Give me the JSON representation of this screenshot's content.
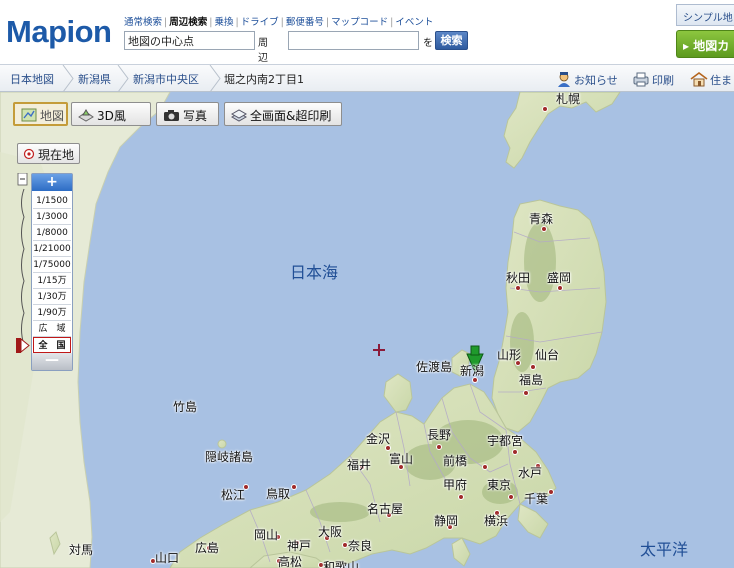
{
  "header": {
    "logo": "Mapion",
    "search_tabs": [
      "通常検索",
      "周辺検索",
      "乗換",
      "ドライブ",
      "郵便番号",
      "マップコード",
      "イベント"
    ],
    "active_tab_index": 1,
    "center_input_value": "地図の中心点",
    "nearby_label": "周辺で",
    "keyword_input_value": "",
    "wo_label": "を",
    "search_button": "検索",
    "simple_tab": "シンプル地",
    "map_green_tab": "地図カ"
  },
  "breadcrumb": [
    "日本地図",
    "新潟県",
    "新潟市中央区",
    "堀之内南2丁目1"
  ],
  "tools": {
    "news": "お知らせ",
    "print": "印刷",
    "residence": "住ま"
  },
  "map_toolbar": {
    "map": "地図",
    "threed": "3D風",
    "photo": "写真",
    "fullscreen": "全画面&超印刷",
    "current_location": "現在地"
  },
  "zoom": {
    "in": "+",
    "out": "—",
    "levels": [
      "1/1500",
      "1/3000",
      "1/8000",
      "1/21000",
      "1/75000",
      "1/15万",
      "1/30万",
      "1/90万",
      "広　域",
      "全　国"
    ],
    "selected_index": 9
  },
  "map": {
    "seas": {
      "sea_of_japan": "日本海",
      "pacific": "太平洋"
    },
    "places": {
      "sapporo": "札幌",
      "aomori": "青森",
      "akita": "秋田",
      "morioka": "盛岡",
      "sadogashima": "佐渡島",
      "niigata": "新潟",
      "yamagata": "山形",
      "sendai": "仙台",
      "fukushima": "福島",
      "takeshima": "竹島",
      "kanazawa": "金沢",
      "nagano": "長野",
      "utsunomiya": "宇都宮",
      "oki": "隠岐諸島",
      "fukui": "福井",
      "toyama": "富山",
      "maebashi": "前橋",
      "mito": "水戸",
      "kofu": "甲府",
      "tokyo": "東京",
      "matsue": "松江",
      "tottori": "鳥取",
      "chiba": "千葉",
      "nagoya": "名古屋",
      "shizuoka": "静岡",
      "yokohama": "横浜",
      "okayama": "岡山",
      "osaka": "大阪",
      "tsushima": "対馬",
      "hiroshima": "広島",
      "kobe": "神戸",
      "nara": "奈良",
      "yamaguchi": "山口",
      "takamatsu": "高松",
      "wakayama": "和歌山"
    }
  }
}
